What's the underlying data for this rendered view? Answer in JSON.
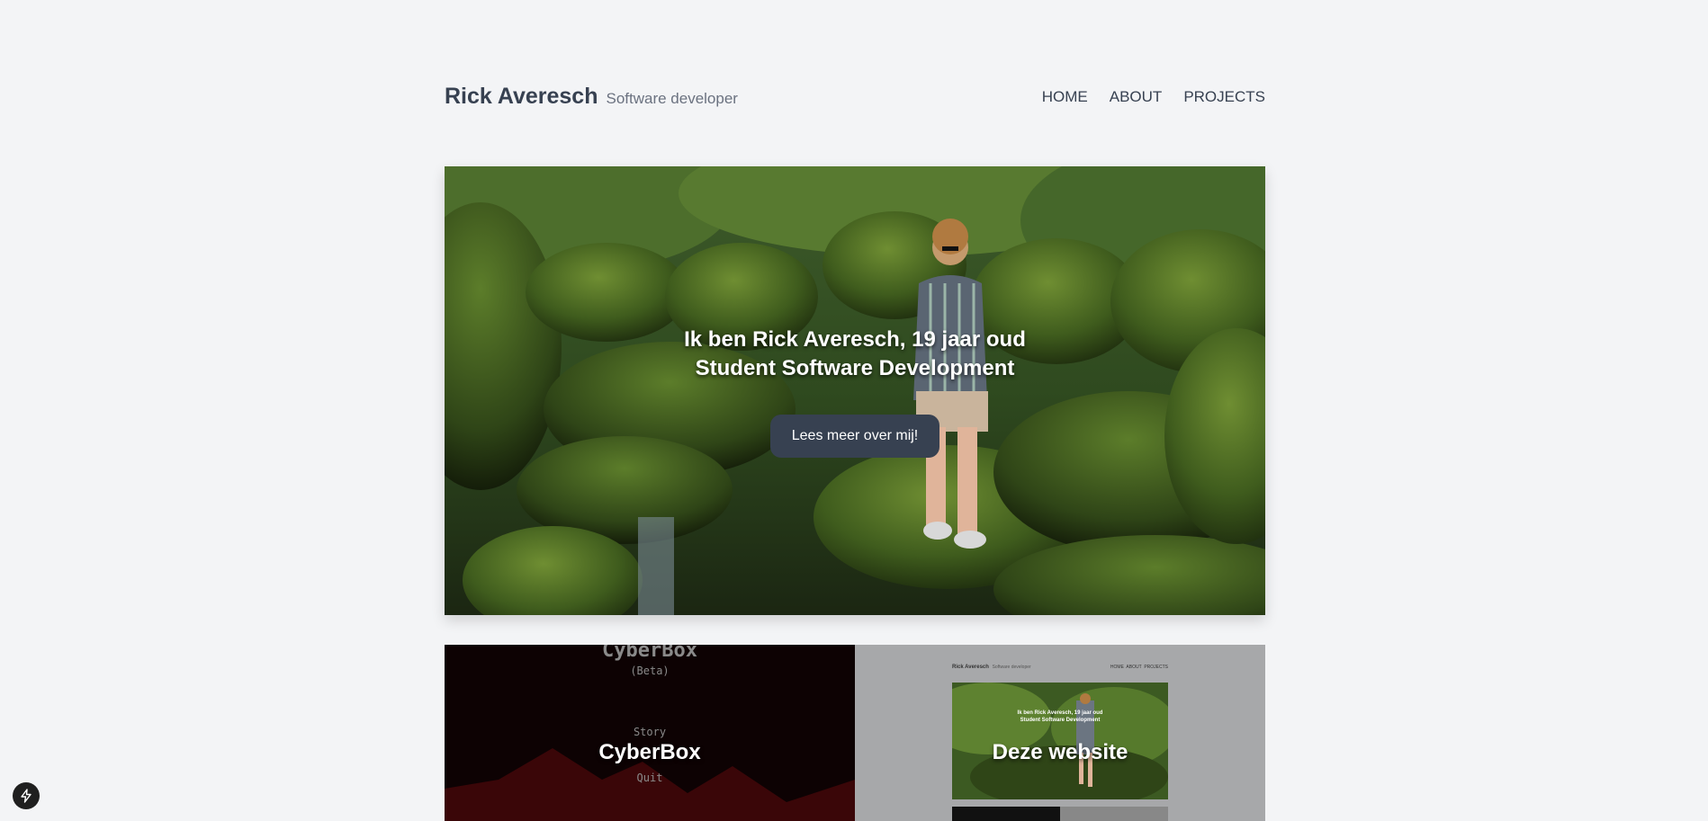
{
  "header": {
    "name": "Rick Averesch",
    "subtitle": "Software developer",
    "nav": [
      "HOME",
      "ABOUT",
      "PROJECTS"
    ]
  },
  "hero": {
    "line1": "Ik ben Rick Averesch, 19 jaar oud",
    "line2": "Student Software Development",
    "button": "Lees meer over mij!"
  },
  "projects": [
    {
      "title": "CyberBox",
      "game_title": "CyberBox",
      "game_beta": "(Beta)",
      "menu_story": "Story",
      "menu_quit": "Quit"
    },
    {
      "title": "Deze website",
      "mini_name": "Rick Averesch",
      "mini_sub": "Software developer",
      "mini_nav": "HOME  ABOUT  PROJECTS",
      "mini_line1": "Ik ben Rick Averesch, 19 jaar oud",
      "mini_line2": "Student Software Development"
    }
  ],
  "colors": {
    "background": "#f3f4f6",
    "text": "#374151",
    "button": "#374151"
  },
  "icons": {
    "floating": "lightning-icon"
  }
}
